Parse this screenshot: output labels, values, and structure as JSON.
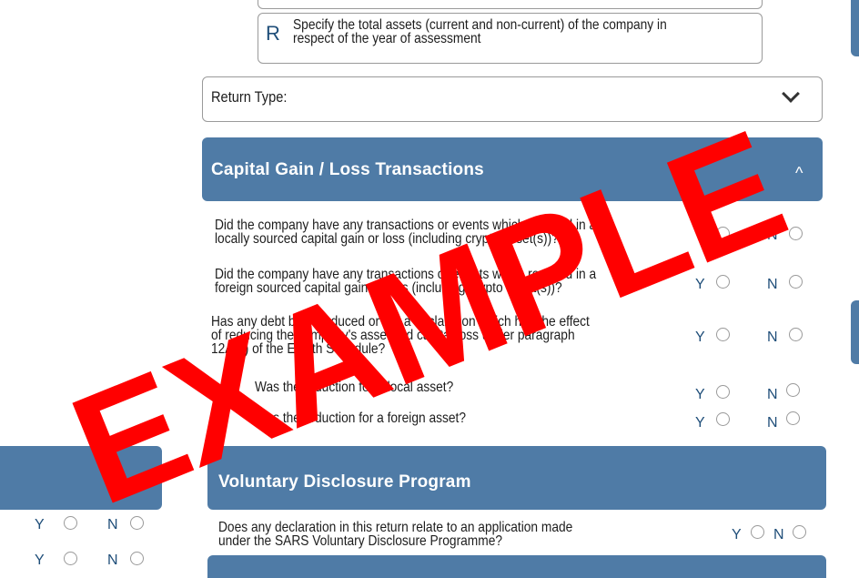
{
  "assets_field": {
    "marker": "R",
    "text_line1": "Specify the total assets (current and non-current) of the company in",
    "text_line2": "respect of the year of assessment"
  },
  "return_type": {
    "label": "Return Type:"
  },
  "capital_gain_section": {
    "title": "Capital Gain / Loss Transactions",
    "caret": "^",
    "questions": [
      {
        "line1": "Did the company have any transactions or events which resulted in a",
        "line2": "locally sourced capital gain or loss (including crypto asset(s))?",
        "line3": "",
        "yes": "Y",
        "no": "N"
      },
      {
        "line1": "Did the company have any transactions or events which resulted in a",
        "line2": "foreign sourced capital gain or loss (including crypto asset(s))?",
        "line3": "",
        "yes": "Y",
        "no": "N"
      },
      {
        "line1": "Has any debt been reduced or not a declaration which has the effect",
        "line2": "of reducing the company's assessed capital loss under paragraph",
        "line3": "12A(4) of the Eighth Schedule?",
        "yes": "Y",
        "no": "N"
      }
    ],
    "sub_questions": [
      {
        "text": "Was the reduction for a local asset?",
        "yes": "Y",
        "no": "N"
      },
      {
        "text": "Was the reduction for a foreign asset?",
        "yes": "Y",
        "no": "N"
      }
    ]
  },
  "voluntary_section": {
    "title": "Voluntary Disclosure Program",
    "question_line1": "Does any declaration in this return relate to an application made",
    "question_line2": "under the SARS Voluntary Disclosure Programme?",
    "yes": "Y",
    "no": "N"
  },
  "left_panel": {
    "caret": "^",
    "rows": [
      {
        "yes": "Y",
        "no": "N"
      },
      {
        "yes": "Y",
        "no": "N"
      }
    ]
  },
  "watermark": "EXAMPLE",
  "colors": {
    "header": "#4f7ba6",
    "watermark": "#ff0000",
    "marker": "#1f4e79"
  }
}
